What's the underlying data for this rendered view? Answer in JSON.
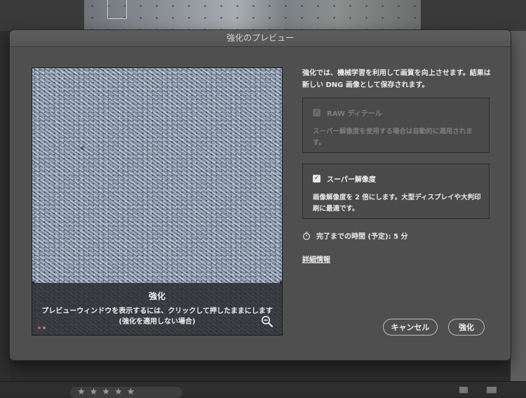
{
  "dialog": {
    "title": "強化のプレビュー",
    "description": "強化では、機械学習を利用して画質を向上させます。結果は新しい DNG 画像として保存されます。",
    "preview": {
      "overlay_title": "強化",
      "overlay_line1": "プレビューウィンドウを表示するには、クリックして押したままにします",
      "overlay_line2": "(強化を適用しない場合)",
      "zoom_icon": "zoom-out-icon"
    },
    "options": {
      "raw_details": {
        "label": "RAW ディテール",
        "description": "スーパー解像度を使用する場合は自動的に適用されます。",
        "checked": true,
        "enabled": false
      },
      "super_resolution": {
        "label": "スーパー解像度",
        "description": "画像解像度を 2 倍にします。大型ディスプレイや大判印刷に最適です。",
        "checked": true,
        "enabled": true
      }
    },
    "estimated_time": "完了までの時間 (予定): 5 分",
    "timer_icon": "stopwatch-icon",
    "learn_more": "詳細情報",
    "buttons": {
      "cancel": "キャンセル",
      "enhance": "強化"
    }
  },
  "background": {
    "rating_stars": "★★★★★"
  }
}
